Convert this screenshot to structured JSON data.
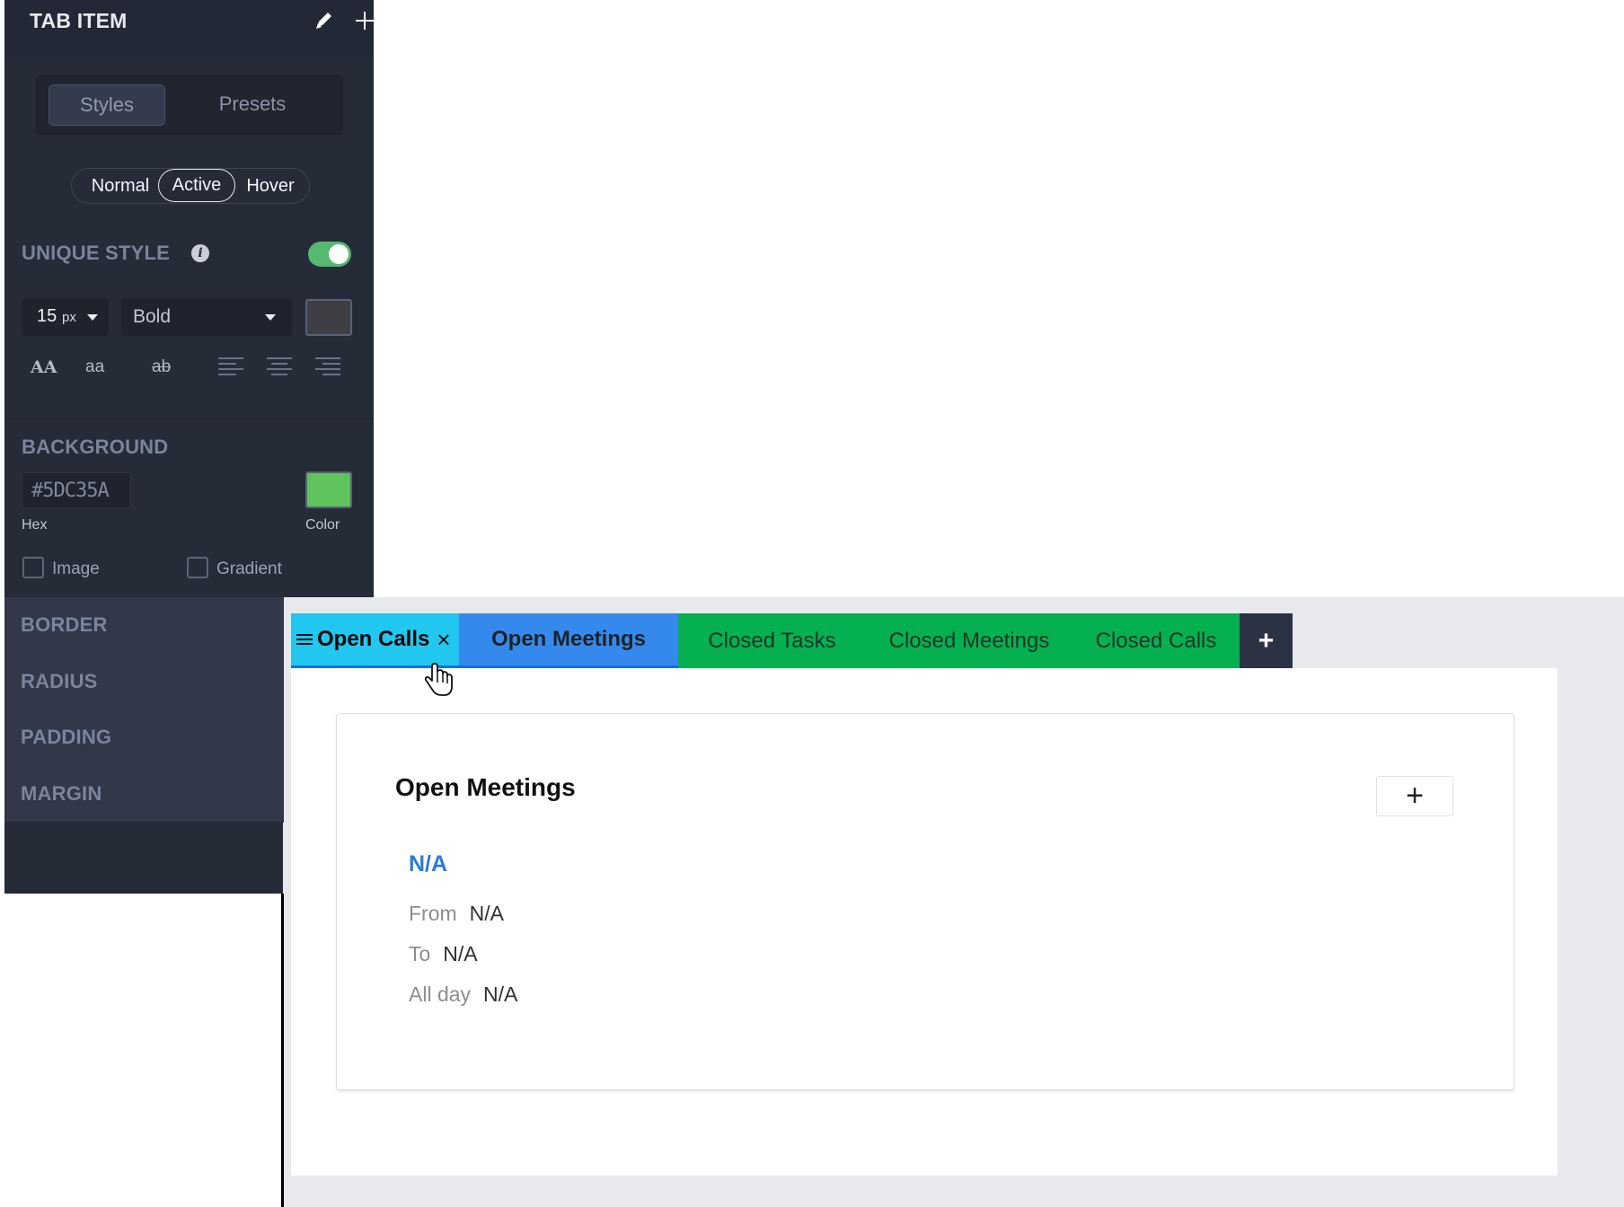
{
  "panel": {
    "title": "TAB ITEM",
    "header_icons": [
      "pencil-icon",
      "plus-icon"
    ],
    "mode_tabs": [
      "Styles",
      "Presets"
    ],
    "active_mode": "Styles",
    "states": [
      "Normal",
      "Active",
      "Hover"
    ],
    "active_state": "Active",
    "unique_style_label": "UNIQUE STYLE",
    "unique_style_enabled": true,
    "font_size_value": "15",
    "font_size_unit": "px",
    "font_weight": "Bold",
    "font_color": "#3d3f44",
    "text_transform": [
      "AA",
      "aa",
      "ab"
    ],
    "background_label": "BACKGROUND",
    "hex_value": "#5DC35A",
    "hex_label": "Hex",
    "color_label": "Color",
    "background_color": "#5dc35a",
    "image_label": "Image",
    "gradient_label": "Gradient",
    "border_label": "BORDER",
    "radius_label": "RADIUS",
    "padding_label": "PADDING",
    "margin_label": "MARGIN"
  },
  "tabs": [
    {
      "label": "Open Calls"
    },
    {
      "label": "Open Meetings"
    },
    {
      "label": "Closed Tasks"
    },
    {
      "label": "Closed Meetings"
    },
    {
      "label": "Closed Calls"
    }
  ],
  "tab_add_symbol": "+",
  "card": {
    "title": "Open Meetings",
    "add_symbol": "+",
    "item_title": "N/A",
    "fields": [
      {
        "label": "From",
        "value": "N/A"
      },
      {
        "label": "To",
        "value": "N/A"
      },
      {
        "label": "All day",
        "value": "N/A"
      }
    ]
  },
  "colors": {
    "panel_bg": "#262b38",
    "tab_open_calls": "#21c7ef",
    "tab_open_meetings": "#3589ec",
    "tab_closed": "#05b050",
    "link_blue": "#2d7bd6",
    "toggle_on": "#55b970"
  }
}
